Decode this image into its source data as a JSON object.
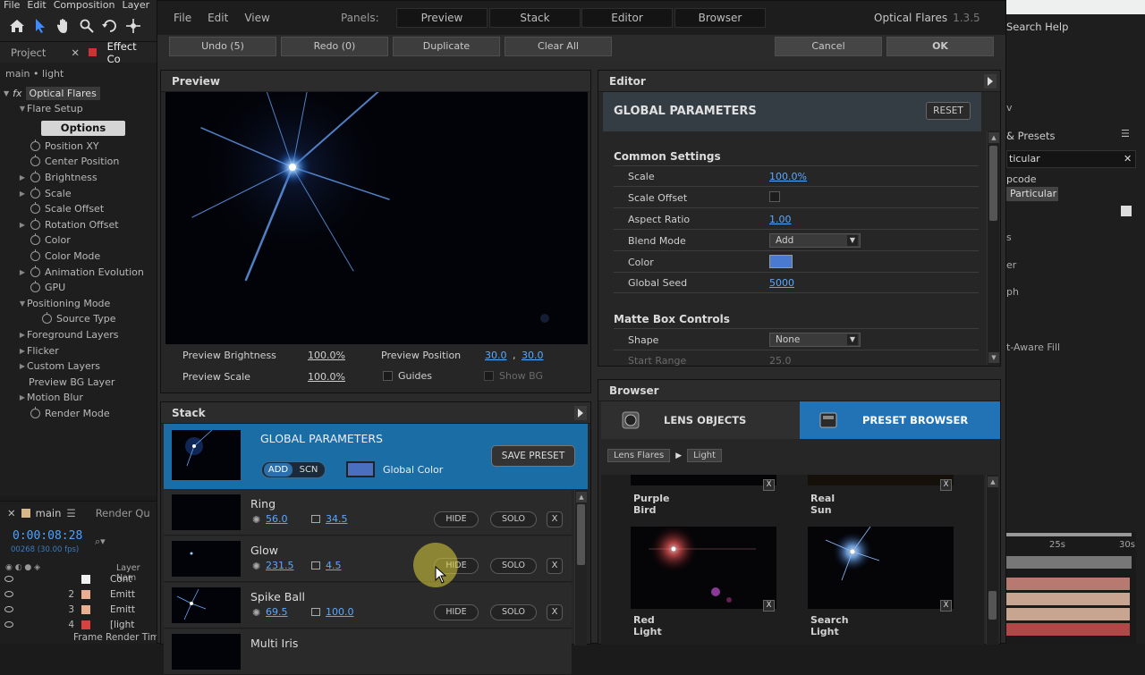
{
  "ae": {
    "menu": [
      "File",
      "Edit",
      "Composition",
      "Layer"
    ],
    "tabs": {
      "project": "Project",
      "effect": "Effect Co"
    },
    "breadcrumb": "main • light",
    "effect_name": "Optical Flares",
    "fx_label": "fx",
    "flare_setup": "Flare Setup",
    "options_label": "Options",
    "params": [
      {
        "label": "Position XY",
        "twirl": false,
        "sw": true
      },
      {
        "label": "Center Position",
        "twirl": false,
        "sw": true
      },
      {
        "label": "Brightness",
        "twirl": true,
        "sw": true
      },
      {
        "label": "Scale",
        "twirl": true,
        "sw": true
      },
      {
        "label": "Scale Offset",
        "twirl": false,
        "sw": true
      },
      {
        "label": "Rotation Offset",
        "twirl": true,
        "sw": true
      },
      {
        "label": "Color",
        "twirl": false,
        "sw": true
      },
      {
        "label": "Color Mode",
        "twirl": false,
        "sw": true
      },
      {
        "label": "Animation Evolution",
        "twirl": true,
        "sw": true
      },
      {
        "label": "GPU",
        "twirl": false,
        "sw": true
      }
    ],
    "positioning_mode": "Positioning Mode",
    "source_type": "Source Type",
    "groups2": [
      "Foreground Layers",
      "Flicker",
      "Custom Layers"
    ],
    "preview_bg_layer": "Preview BG Layer",
    "motion_blur": "Motion Blur",
    "render_mode": "Render Mode",
    "timeline": {
      "comp_tab": "main",
      "render_tab": "Render Qu",
      "timecode": "0:00:08:28",
      "frames": "00268 (30.00 fps)",
      "layer_name_header": "Layer Nam",
      "rows": [
        {
          "num": "",
          "name": "Cont",
          "color": "#f0f0f0"
        },
        {
          "num": "2",
          "name": "Emitt",
          "color": "#e8b090"
        },
        {
          "num": "3",
          "name": "Emitt",
          "color": "#e8b090"
        },
        {
          "num": "4",
          "name": "[light",
          "color": "#d94040"
        }
      ],
      "frame_render_time": "Frame Render Time"
    },
    "right": {
      "search_help": "Search Help",
      "fx_presets": "& Presets",
      "search_value": "ticular",
      "pcode": "pcode",
      "particular": "Particular",
      "aware_fill": "t-Aware Fill",
      "txt_v": "v",
      "txt_s": "s",
      "txt_er": "er",
      "txt_ph": "ph",
      "ruler_25": "25s",
      "ruler_30": "30s"
    }
  },
  "of": {
    "menu": [
      "File",
      "Edit",
      "View"
    ],
    "panels_label": "Panels:",
    "panel_tabs": [
      "Preview",
      "Stack",
      "Editor",
      "Browser"
    ],
    "title": "Optical Flares",
    "version": "1.3.5",
    "toolbar": {
      "undo": "Undo (5)",
      "redo": "Redo (0)",
      "duplicate": "Duplicate",
      "clear_all": "Clear All",
      "cancel": "Cancel",
      "ok": "OK"
    },
    "preview": {
      "title": "Preview",
      "brightness_label": "Preview Brightness",
      "brightness_value": "100.0%",
      "scale_label": "Preview Scale",
      "scale_value": "100.0%",
      "position_label": "Preview Position",
      "position_x": "30.0",
      "position_sep": ",",
      "position_y": "30.0",
      "guides_label": "Guides",
      "showbg_label": "Show BG"
    },
    "editor": {
      "title": "Editor",
      "header": "GLOBAL PARAMETERS",
      "reset": "RESET",
      "section_common": "Common Settings",
      "scale_label": "Scale",
      "scale_value": "100.0%",
      "scale_offset_label": "Scale Offset",
      "aspect_label": "Aspect Ratio",
      "aspect_value": "1.00",
      "blend_label": "Blend Mode",
      "blend_value": "Add",
      "color_label": "Color",
      "color_value": "#4a7ad0",
      "seed_label": "Global Seed",
      "seed_value": "5000",
      "section_matte": "Matte Box Controls",
      "shape_label": "Shape",
      "shape_value": "None",
      "start_range_label": "Start Range",
      "start_range_value": "25.0"
    },
    "stack": {
      "title": "Stack",
      "global_title": "GLOBAL PARAMETERS",
      "add": "ADD",
      "scn": "SCN",
      "global_color_label": "Global Color",
      "save_preset": "SAVE PRESET",
      "items": [
        {
          "name": "Ring",
          "brightness": "56.0",
          "scale": "34.5"
        },
        {
          "name": "Glow",
          "brightness": "231.5",
          "scale": "4.5"
        },
        {
          "name": "Spike Ball",
          "brightness": "69.5",
          "scale": "100.0"
        },
        {
          "name": "Multi Iris",
          "brightness": "",
          "scale": ""
        }
      ],
      "hide": "HIDE",
      "solo": "SOLO",
      "x": "X"
    },
    "browser": {
      "title": "Browser",
      "tab_lens": "LENS OBJECTS",
      "tab_preset": "PRESET BROWSER",
      "crumb1": "Lens Flares",
      "crumb2": "Light",
      "presets": [
        "Purple Bird",
        "Real Sun",
        "Red Light",
        "Search Light"
      ],
      "x": "X"
    }
  }
}
